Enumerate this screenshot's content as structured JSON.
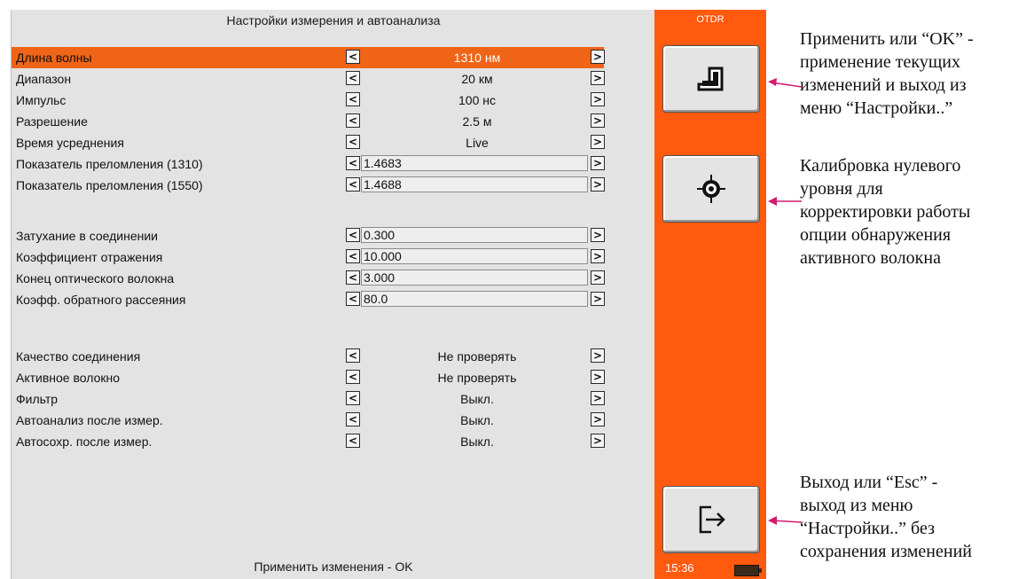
{
  "panel": {
    "title": "Настройки измерения и автоанализа",
    "status": "Применить изменения - OK"
  },
  "rows": [
    {
      "label": "Длина волны",
      "value": "1310 нм",
      "kind": "choice",
      "selected": true
    },
    {
      "label": "Диапазон",
      "value": "20 км",
      "kind": "choice"
    },
    {
      "label": "Импульс",
      "value": "100 нс",
      "kind": "choice"
    },
    {
      "label": "Разрешение",
      "value": "2.5 м",
      "kind": "choice"
    },
    {
      "label": "Время усреднения",
      "value": "Live",
      "kind": "choice"
    },
    {
      "label": "Показатель преломления (1310)",
      "value": "1.4683",
      "kind": "field"
    },
    {
      "label": "Показатель преломления (1550)",
      "value": "1.4688",
      "kind": "field"
    },
    {
      "label": "Затухание в соединении",
      "value": "0.300",
      "kind": "field"
    },
    {
      "label": "Коэффициент отражения",
      "value": "10.000",
      "kind": "field"
    },
    {
      "label": "Конец оптического волокна",
      "value": "3.000",
      "kind": "field"
    },
    {
      "label": "Коэфф. обратного рассеяния",
      "value": "80.0",
      "kind": "field"
    },
    {
      "label": "Качество соединения",
      "value": "Не проверять",
      "kind": "choice"
    },
    {
      "label": "Активное волокно",
      "value": "Не проверять",
      "kind": "choice"
    },
    {
      "label": "Фильтр",
      "value": "Выкл.",
      "kind": "choice"
    },
    {
      "label": "Автоанализ после измер.",
      "value": "Выкл.",
      "kind": "choice"
    },
    {
      "label": "Автосохр. после измер.",
      "value": "Выкл.",
      "kind": "choice"
    }
  ],
  "arrows": {
    "left": "<",
    "right": ">"
  },
  "sidebar": {
    "title": "OTDR",
    "clock": "15:36",
    "buttons": [
      {
        "icon": "apply-enter-icon"
      },
      {
        "icon": "target-calibrate-icon"
      },
      {
        "icon": "exit-icon"
      }
    ]
  },
  "annotations": {
    "apply": [
      "Применить или “OK” -",
      "применение текущих",
      "изменений и выход из",
      "меню “Настройки..”"
    ],
    "calibrate": [
      "Калибровка нулевого",
      "уровня для",
      "корректировки работы",
      "опции обнаружения",
      "активного волокна"
    ],
    "exit": [
      "Выход или “Esc” -",
      "выход из меню",
      "“Настройки..” без",
      "сохранения изменений"
    ]
  },
  "colors": {
    "accent": "#ff5a0e",
    "selected_row": "#f06418",
    "annotation_arrow": "#d21a6e"
  }
}
